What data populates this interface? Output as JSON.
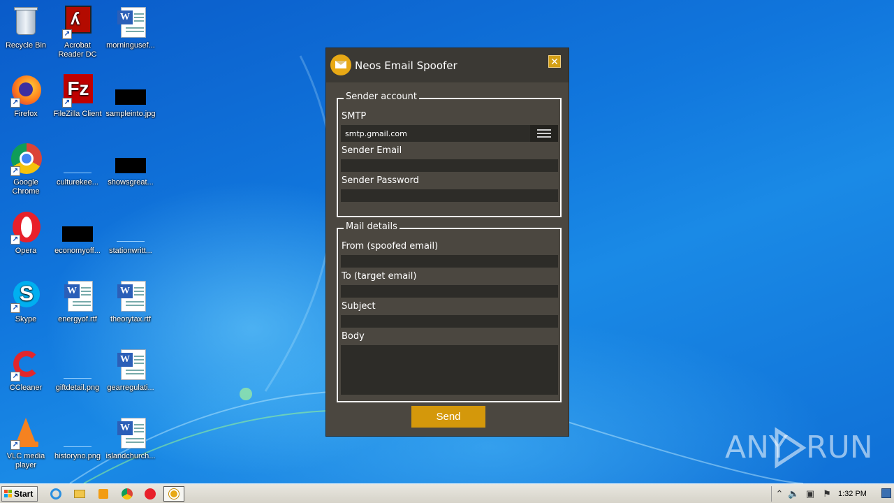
{
  "desktop": {
    "icons": [
      {
        "label": "Recycle Bin",
        "label2": ""
      },
      {
        "label": "Acrobat",
        "label2": "Reader DC"
      },
      {
        "label": "morningusef...",
        "label2": ""
      },
      {
        "label": "Firefox",
        "label2": ""
      },
      {
        "label": "FileZilla Client",
        "label2": ""
      },
      {
        "label": "sampleinto.jpg",
        "label2": ""
      },
      {
        "label": "Google",
        "label2": "Chrome"
      },
      {
        "label": "culturekee...",
        "label2": ""
      },
      {
        "label": "showsgreat...",
        "label2": ""
      },
      {
        "label": "Opera",
        "label2": ""
      },
      {
        "label": "economyoff...",
        "label2": ""
      },
      {
        "label": "stationwritt...",
        "label2": ""
      },
      {
        "label": "Skype",
        "label2": ""
      },
      {
        "label": "energyof.rtf",
        "label2": ""
      },
      {
        "label": "theorytax.rtf",
        "label2": ""
      },
      {
        "label": "CCleaner",
        "label2": ""
      },
      {
        "label": "giftdetail.png",
        "label2": ""
      },
      {
        "label": "gearregulati...",
        "label2": ""
      },
      {
        "label": "VLC media",
        "label2": "player"
      },
      {
        "label": "historyno.png",
        "label2": ""
      },
      {
        "label": "islandchurch...",
        "label2": ""
      }
    ]
  },
  "app": {
    "title": "Neos Email Spoofer",
    "close_label": "✕",
    "sender_account": {
      "legend": "Sender account",
      "smtp_label": "SMTP",
      "smtp_value": "smtp.gmail.com",
      "sender_email_label": "Sender Email",
      "sender_email_value": "",
      "sender_password_label": "Sender Password",
      "sender_password_value": ""
    },
    "mail_details": {
      "legend": "Mail details",
      "from_label": "From (spoofed email)",
      "from_value": "",
      "to_label": "To (target email)",
      "to_value": "",
      "subject_label": "Subject",
      "subject_value": "",
      "body_label": "Body",
      "body_value": ""
    },
    "send_label": "Send",
    "accent_color": "#d4980b"
  },
  "watermark": {
    "left": "ANY",
    "right": "RUN"
  },
  "taskbar": {
    "start_label": "Start",
    "clock": "1:32 PM"
  }
}
